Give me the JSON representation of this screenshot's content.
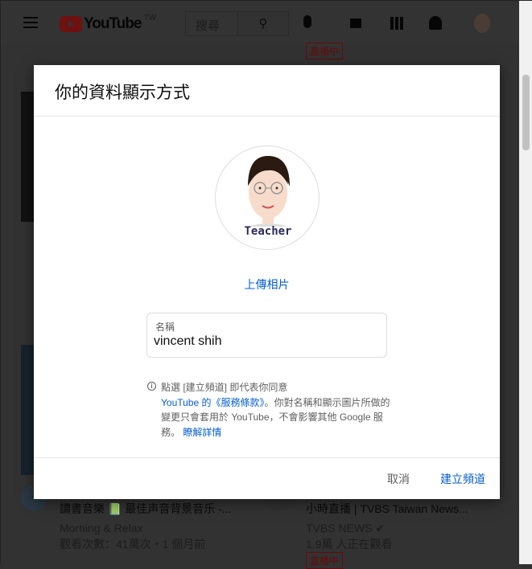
{
  "header": {
    "logo_text": "YouTube",
    "region": "TW",
    "search_placeholder": "搜尋"
  },
  "background": {
    "live_badge": "直播中",
    "videos": [
      {
        "title": "讀書音樂 📗 最佳声音背景音乐 -...",
        "channel": "Morning & Relax",
        "meta": "觀看次數：41萬次・1 個月前"
      },
      {
        "title": "小時直播 | TVBS Taiwan News...",
        "channel": "TVBS NEWS",
        "meta": "1.9萬 人正在觀看",
        "badge": "直播中"
      }
    ]
  },
  "dialog": {
    "title": "你的資料顯示方式",
    "avatar_caption": "Teacher",
    "upload_label": "上傳相片",
    "name_label": "名稱",
    "name_value": "vincent shih",
    "notice_line1": "點選 [建立頻道] 即代表你同意",
    "terms_link": "YouTube 的《服務條款》",
    "notice_rest": "。你對名稱和顯示圖片所做的變更只會套用於 YouTube，不會影響其他 Google 服務。",
    "learn_more": "瞭解詳情",
    "cancel_label": "取消",
    "create_label": "建立頻道"
  },
  "colors": {
    "accent": "#065fd4",
    "youtube_red": "#ff0000"
  }
}
